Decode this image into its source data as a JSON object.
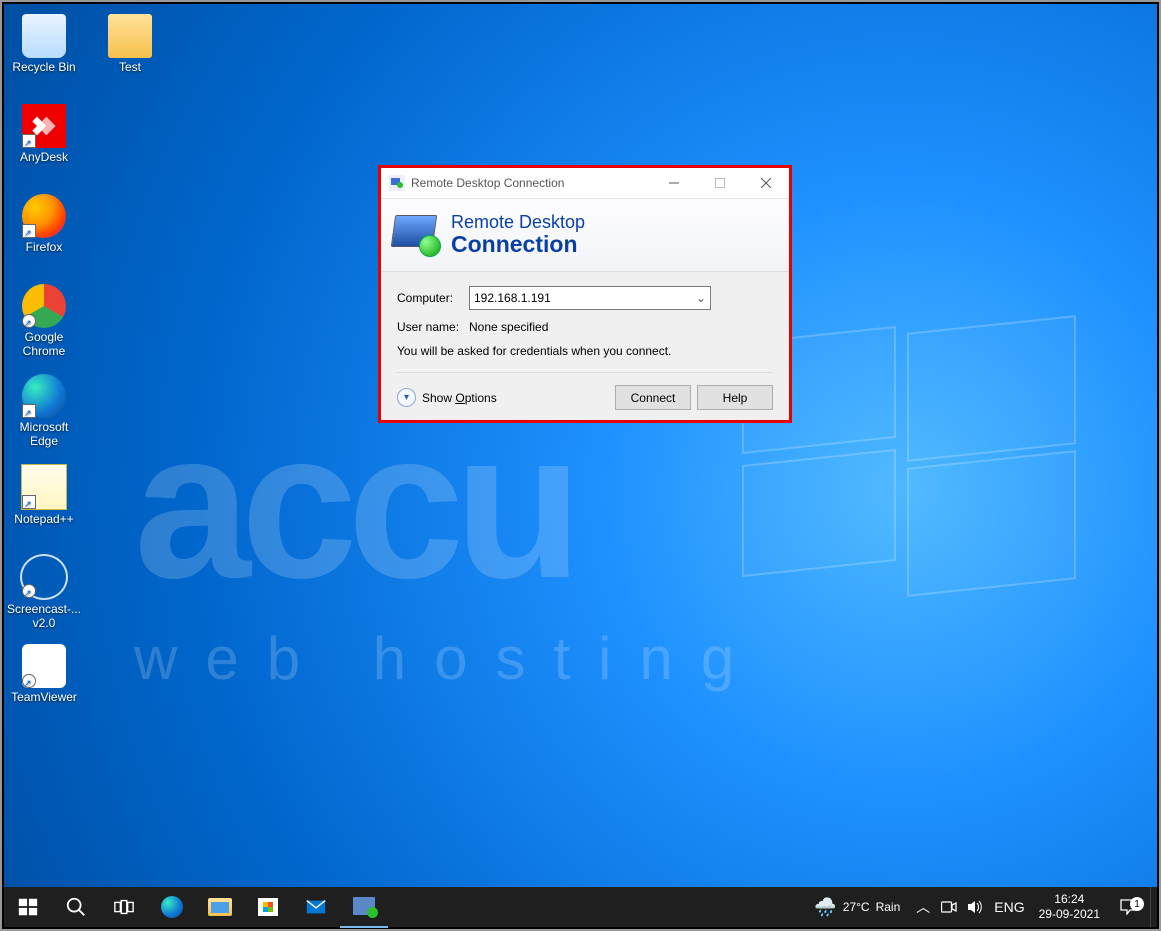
{
  "desktop_icons": [
    {
      "label": "Recycle Bin",
      "key": "recycle"
    },
    {
      "label": "AnyDesk",
      "key": "anydesk"
    },
    {
      "label": "Firefox",
      "key": "firefox"
    },
    {
      "label": "Google Chrome",
      "key": "chrome"
    },
    {
      "label": "Microsoft Edge",
      "key": "edge"
    },
    {
      "label": "Notepad++",
      "key": "npp"
    },
    {
      "label": "Screencast-... v2.0",
      "key": "cast"
    },
    {
      "label": "TeamViewer",
      "key": "tv"
    }
  ],
  "desktop_icons_col2": [
    {
      "label": "Test",
      "key": "folder"
    }
  ],
  "dialog": {
    "title": "Remote Desktop Connection",
    "brand_line1": "Remote Desktop",
    "brand_line2": "Connection",
    "computer_label": "Computer:",
    "computer_value": "192.168.1.191",
    "username_label": "User name:",
    "username_value": "None specified",
    "info": "You will be asked for credentials when you connect.",
    "show_options_prefix": "Show ",
    "show_options_accel": "O",
    "show_options_suffix": "ptions",
    "connect": "Connect",
    "help": "Help"
  },
  "taskbar": {
    "weather_temp": "27°C",
    "weather_cond": "Rain",
    "lang": "ENG",
    "time": "16:24",
    "date": "29-09-2021",
    "notif_count": "1"
  },
  "watermark": {
    "big": "accu",
    "small": "web hosting"
  }
}
